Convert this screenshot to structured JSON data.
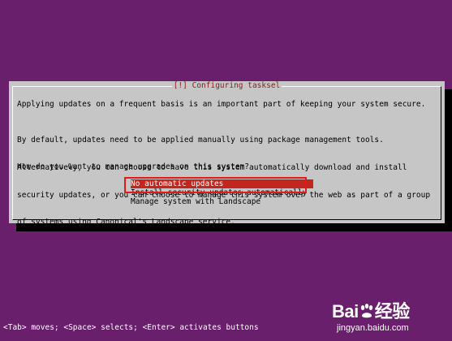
{
  "dialog": {
    "title": "[!] Configuring tasksel",
    "paragraph1": "Applying updates on a frequent basis is an important part of keeping your system secure.",
    "paragraph2_lines": [
      "By default, updates need to be applied manually using package management tools.",
      "Alternatively, you can choose to have this system automatically download and install",
      "security updates, or you can choose to manage this system over the web as part of a group",
      "of systems using Canonical's Landscape service."
    ],
    "question": "How do you want to manage upgrades on this system?",
    "options": [
      "No automatic updates",
      "Install security updates automatically",
      "Manage system with Landscape"
    ],
    "selected_index": 0
  },
  "status_bar": "<Tab> moves; <Space> selects; <Enter> activates buttons",
  "watermark": {
    "logo_text_left": "Bai",
    "logo_text_right": "经验",
    "url": "jingyan.baidu.com"
  },
  "colors": {
    "background": "#6a1f6d",
    "dialog": "#c6c6c6",
    "title": "#8b1c1c",
    "selection": "#c2261e",
    "annotation": "#e21a1a"
  }
}
